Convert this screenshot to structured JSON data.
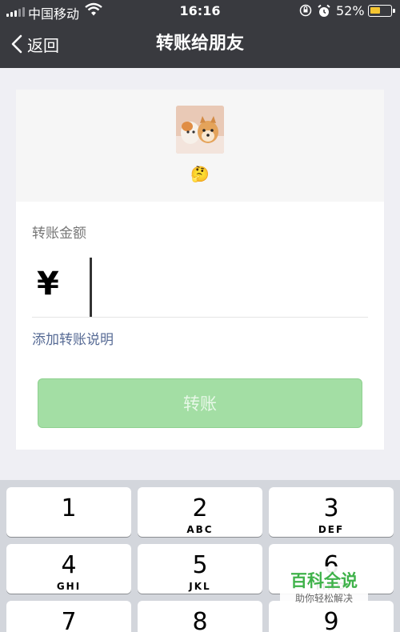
{
  "status": {
    "carrier": "中国移动",
    "time": "16:16",
    "battery": "52%",
    "battery_level": 0.52
  },
  "nav": {
    "back_label": "返回",
    "title": "转账给朋友"
  },
  "friend": {
    "name_emoji": "🤔"
  },
  "transfer": {
    "amount_label": "转账金额",
    "currency": "¥",
    "amount_value": "",
    "add_note": "添加转账说明",
    "button_label": "转账"
  },
  "keypad": {
    "keys": [
      {
        "num": "1",
        "letters": ""
      },
      {
        "num": "2",
        "letters": "ABC"
      },
      {
        "num": "3",
        "letters": "DEF"
      },
      {
        "num": "4",
        "letters": "GHI"
      },
      {
        "num": "5",
        "letters": "JKL"
      },
      {
        "num": "6",
        "letters": "MNO"
      },
      {
        "num": "7",
        "letters": ""
      },
      {
        "num": "8",
        "letters": ""
      },
      {
        "num": "9",
        "letters": ""
      }
    ]
  },
  "watermark": {
    "main": "百科全说",
    "sub": "助你轻松解决"
  },
  "colors": {
    "nav_bg": "#393a3f",
    "button_disabled": "#a3dea4",
    "link": "#576b95",
    "battery": "#f5c531"
  }
}
